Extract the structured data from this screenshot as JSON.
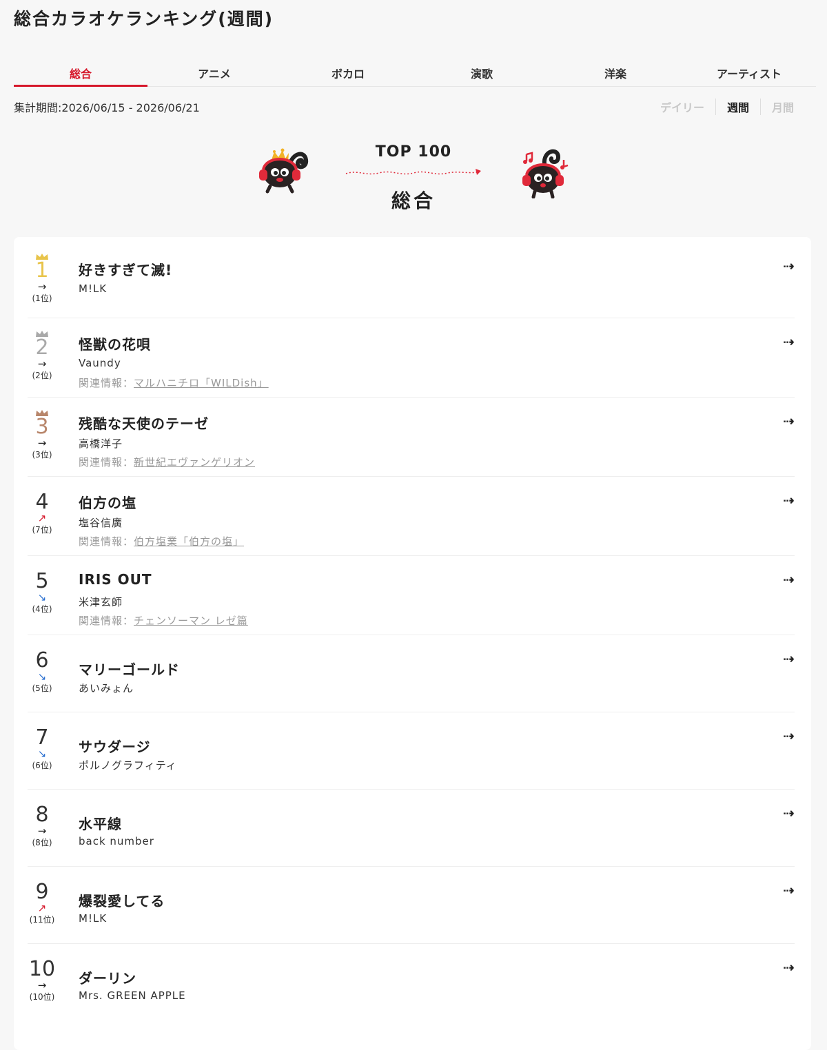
{
  "page": {
    "title": "総合カラオケランキング(週間)"
  },
  "tabs": [
    {
      "label": "総合"
    },
    {
      "label": "アニメ"
    },
    {
      "label": "ボカロ"
    },
    {
      "label": "演歌"
    },
    {
      "label": "洋楽"
    },
    {
      "label": "アーティスト"
    }
  ],
  "period": "集計期間:2026/06/15 - 2026/06/21",
  "term": {
    "daily": "デイリー",
    "weekly": "週間",
    "monthly": "月間"
  },
  "hero": {
    "top": "TOP 100",
    "category": "総合"
  },
  "related_label": "関連情報：",
  "colors": {
    "accent": "#d6182b",
    "gold": "#e8c44a",
    "silver": "#a9a9a9",
    "bronze": "#b8866b"
  },
  "rankings": [
    {
      "rank": "1",
      "trend": "→",
      "trend_dir": "flat",
      "prev": "(1位)",
      "title": "好きすぎて滅!",
      "artist": "M!LK",
      "related": "",
      "crown": "gold"
    },
    {
      "rank": "2",
      "trend": "→",
      "trend_dir": "flat",
      "prev": "(2位)",
      "title": "怪獣の花唄",
      "artist": "Vaundy",
      "related": "マルハニチロ「WILDish」",
      "crown": "silver"
    },
    {
      "rank": "3",
      "trend": "→",
      "trend_dir": "flat",
      "prev": "(3位)",
      "title": "残酷な天使のテーゼ",
      "artist": "高橋洋子",
      "related": "新世紀エヴァンゲリオン",
      "crown": "bronze"
    },
    {
      "rank": "4",
      "trend": "↗",
      "trend_dir": "up",
      "prev": "(7位)",
      "title": "伯方の塩",
      "artist": "塩谷信廣",
      "related": "伯方塩業「伯方の塩」",
      "crown": ""
    },
    {
      "rank": "5",
      "trend": "↘",
      "trend_dir": "down",
      "prev": "(4位)",
      "title": "IRIS OUT",
      "artist": "米津玄師",
      "related": "チェンソーマン レゼ篇",
      "crown": ""
    },
    {
      "rank": "6",
      "trend": "↘",
      "trend_dir": "down",
      "prev": "(5位)",
      "title": "マリーゴールド",
      "artist": "あいみょん",
      "related": "",
      "crown": ""
    },
    {
      "rank": "7",
      "trend": "↘",
      "trend_dir": "down",
      "prev": "(6位)",
      "title": "サウダージ",
      "artist": "ポルノグラフィティ",
      "related": "",
      "crown": ""
    },
    {
      "rank": "8",
      "trend": "→",
      "trend_dir": "flat",
      "prev": "(8位)",
      "title": "水平線",
      "artist": "back number",
      "related": "",
      "crown": ""
    },
    {
      "rank": "9",
      "trend": "↗",
      "trend_dir": "up",
      "prev": "(11位)",
      "title": "爆裂愛してる",
      "artist": "M!LK",
      "related": "",
      "crown": ""
    },
    {
      "rank": "10",
      "trend": "→",
      "trend_dir": "flat",
      "prev": "(10位)",
      "title": "ダーリン",
      "artist": "Mrs. GREEN APPLE",
      "related": "",
      "crown": ""
    }
  ]
}
